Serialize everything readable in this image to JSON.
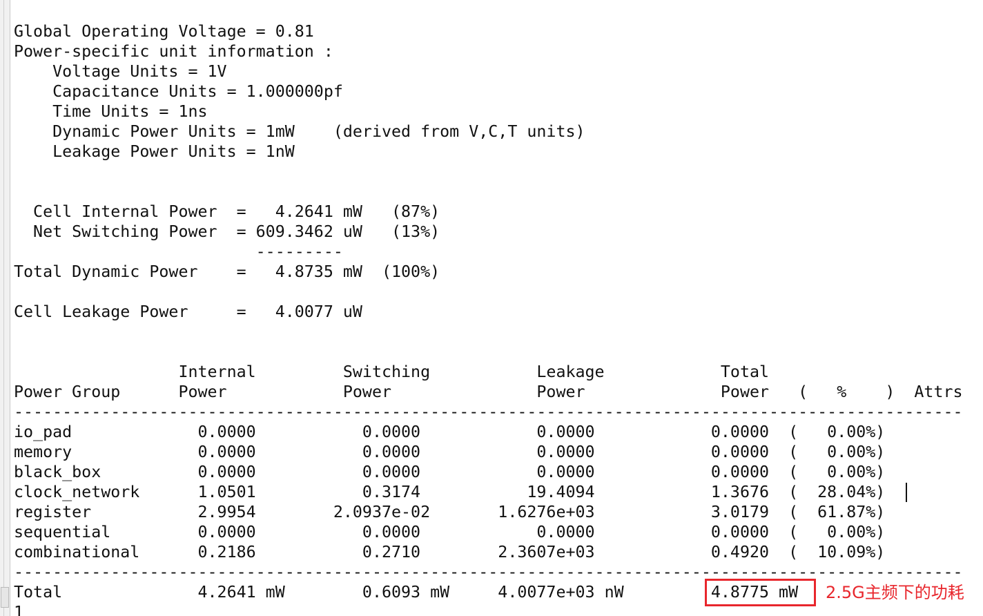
{
  "terminal": {
    "lines": [
      "Global Operating Voltage = 0.81",
      "Power-specific unit information :",
      "    Voltage Units = 1V",
      "    Capacitance Units = 1.000000pf",
      "    Time Units = 1ns",
      "    Dynamic Power Units = 1mW    (derived from V,C,T units)",
      "    Leakage Power Units = 1nW",
      "",
      "",
      "  Cell Internal Power  =   4.2641 mW   (87%)",
      "  Net Switching Power  = 609.3462 uW   (13%)",
      "                         ---------",
      "Total Dynamic Power    =   4.8735 mW  (100%)",
      "",
      "Cell Leakage Power     =   4.0077 uW",
      "",
      "",
      "                 Internal         Switching           Leakage            Total",
      "Power Group      Power            Power               Power              Power   (   %    )  Attrs",
      "--------------------------------------------------------------------------------------------------",
      "io_pad             0.0000           0.0000            0.0000            0.0000  (   0.00%)",
      "memory             0.0000           0.0000            0.0000            0.0000  (   0.00%)",
      "black_box          0.0000           0.0000            0.0000            0.0000  (   0.00%)",
      "clock_network      1.0501           0.3174           19.4094            1.3676  (  28.04%)",
      "register           2.9954        2.0937e-02       1.6276e+03            3.0179  (  61.87%)",
      "sequential         0.0000           0.0000            0.0000            0.0000  (   0.00%)",
      "combinational      0.2186           0.2710        2.3607e+03            0.4920  (  10.09%)",
      "--------------------------------------------------------------------------------------------------",
      "Total              4.2641 mW        0.6093 mW     4.0077e+03 nW         4.8775 mW",
      "1"
    ]
  },
  "annotation": {
    "text": "2.5G主频下的功耗",
    "color": "#e8262c"
  },
  "colors": {
    "background": "#ffffff",
    "text": "#111111",
    "highlight": "#e8262c"
  }
}
